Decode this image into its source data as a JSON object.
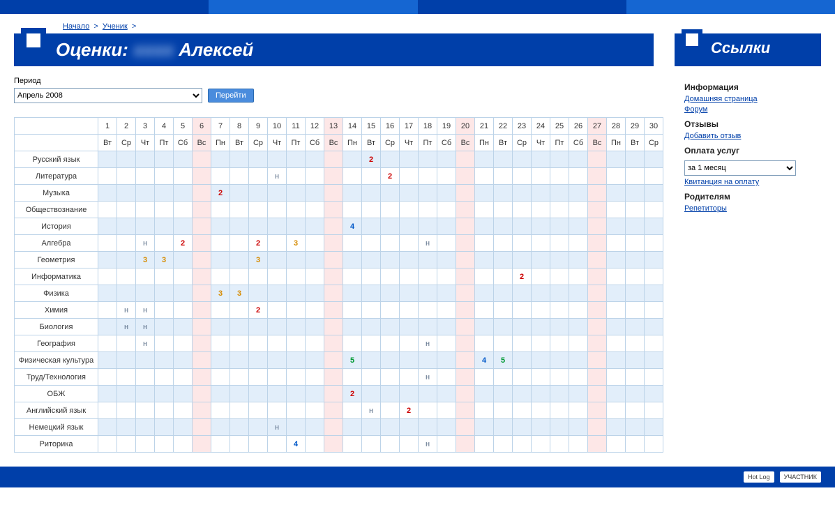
{
  "breadcrumb": {
    "home": "Начало",
    "student": "Ученик"
  },
  "header": {
    "title_prefix": "Оценки:",
    "student_name": "Алексей",
    "links_title": "Ссылки"
  },
  "period": {
    "label": "Период",
    "value": "Апрель 2008",
    "go": "Перейти"
  },
  "sidebar": {
    "info_h": "Информация",
    "info_links": [
      "Домашняя страница",
      "Форум"
    ],
    "reviews_h": "Отзывы",
    "reviews_links": [
      "Добавить отзыв"
    ],
    "pay_h": "Оплата услуг",
    "pay_select": "за 1 месяц",
    "pay_links": [
      "Квитанция на оплату"
    ],
    "parents_h": "Родителям",
    "parents_links": [
      "Репетиторы"
    ]
  },
  "footer": {
    "chip1": "Hot Log",
    "chip2": "УЧАСТНИК"
  },
  "days": {
    "nums": [
      "1",
      "2",
      "3",
      "4",
      "5",
      "6",
      "7",
      "8",
      "9",
      "10",
      "11",
      "12",
      "13",
      "14",
      "15",
      "16",
      "17",
      "18",
      "19",
      "20",
      "21",
      "22",
      "23",
      "24",
      "25",
      "26",
      "27",
      "28",
      "29",
      "30"
    ],
    "dows": [
      "Вт",
      "Ср",
      "Чт",
      "Пт",
      "Сб",
      "Вс",
      "Пн",
      "Вт",
      "Ср",
      "Чт",
      "Пт",
      "Сб",
      "Вс",
      "Пн",
      "Вт",
      "Ср",
      "Чт",
      "Пт",
      "Сб",
      "Вс",
      "Пн",
      "Вт",
      "Ср",
      "Чт",
      "Пт",
      "Сб",
      "Вс",
      "Пн",
      "Вт",
      "Ср"
    ],
    "weekend": [
      false,
      false,
      false,
      false,
      false,
      true,
      false,
      false,
      false,
      false,
      false,
      false,
      true,
      false,
      false,
      false,
      false,
      false,
      false,
      true,
      false,
      false,
      false,
      false,
      false,
      false,
      true,
      false,
      false,
      false
    ]
  },
  "subjects": [
    {
      "name": "Русский язык",
      "marks": {
        "15": "2"
      }
    },
    {
      "name": "Литература",
      "marks": {
        "10": "н",
        "16": "2"
      }
    },
    {
      "name": "Музыка",
      "marks": {
        "7": "2"
      }
    },
    {
      "name": "Обществознание",
      "marks": {}
    },
    {
      "name": "История",
      "marks": {
        "14": "4"
      }
    },
    {
      "name": "Алгебра",
      "marks": {
        "3": "н",
        "5": "2",
        "9": "2",
        "11": "3",
        "18": "н"
      }
    },
    {
      "name": "Геометрия",
      "marks": {
        "3": "3",
        "4": "3",
        "9": "3"
      }
    },
    {
      "name": "Информатика",
      "marks": {
        "23": "2"
      }
    },
    {
      "name": "Физика",
      "marks": {
        "7": "3",
        "8": "3"
      }
    },
    {
      "name": "Химия",
      "marks": {
        "2": "н",
        "3": "н",
        "9": "2"
      }
    },
    {
      "name": "Биология",
      "marks": {
        "2": "н",
        "3": "н"
      }
    },
    {
      "name": "География",
      "marks": {
        "3": "н",
        "18": "н"
      }
    },
    {
      "name": "Физическая культура",
      "marks": {
        "14": "5",
        "21": "4",
        "22": "5"
      }
    },
    {
      "name": "Труд/Технология",
      "marks": {
        "18": "н"
      }
    },
    {
      "name": "ОБЖ",
      "marks": {
        "14": "2"
      }
    },
    {
      "name": "Английский язык",
      "marks": {
        "15": "н",
        "17": "2"
      }
    },
    {
      "name": "Немецкий язык",
      "marks": {
        "10": "н"
      }
    },
    {
      "name": "Риторика",
      "marks": {
        "11": "4",
        "18": "н"
      }
    }
  ]
}
